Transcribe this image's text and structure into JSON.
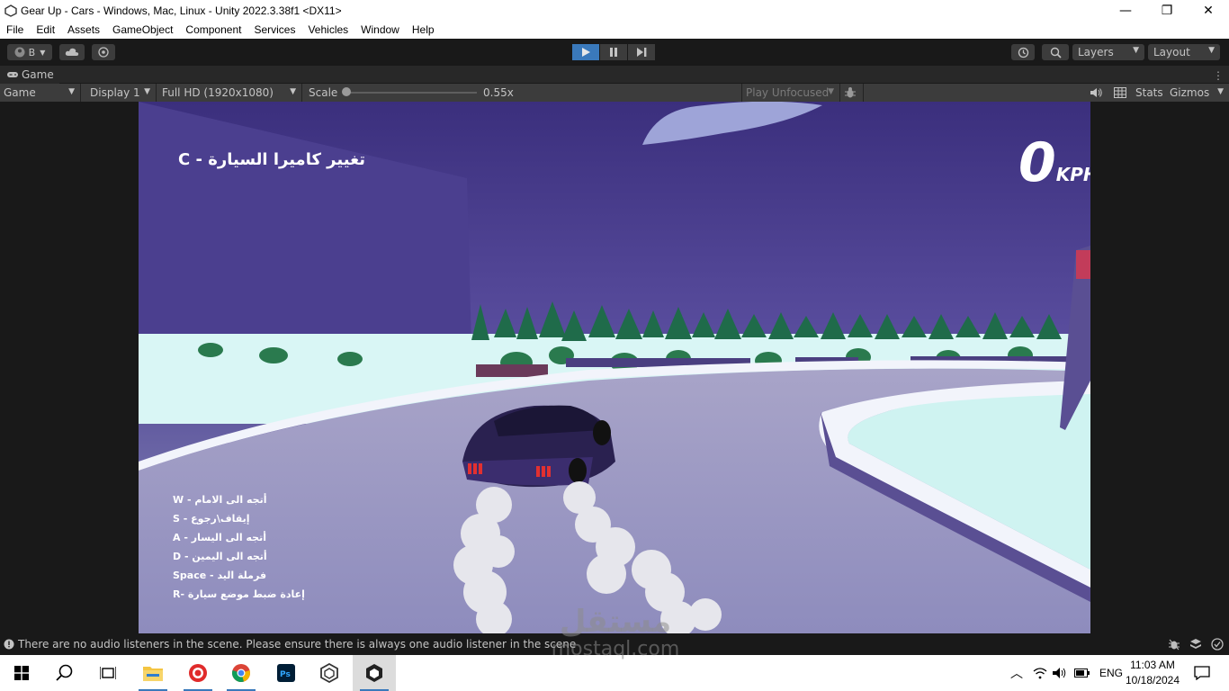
{
  "window": {
    "title": "Gear Up - Cars - Windows, Mac, Linux - Unity 2022.3.38f1 <DX11>",
    "minimize": "—",
    "maximize": "❐",
    "close": "✕"
  },
  "menu": [
    "File",
    "Edit",
    "Assets",
    "GameObject",
    "Component",
    "Services",
    "Vehicles",
    "Window",
    "Help"
  ],
  "toolbar": {
    "account_label": "B",
    "layers_label": "Layers",
    "layout_label": "Layout"
  },
  "tab": {
    "label": "Game"
  },
  "gamebar": {
    "mode": "Game",
    "display": "Display 1",
    "resolution": "Full HD (1920x1080)",
    "scale_label": "Scale",
    "scale_value": "0.55x",
    "scale_fraction": 0.0,
    "play_focus": "Play Unfocused",
    "stats": "Stats",
    "gizmos": "Gizmos"
  },
  "hud": {
    "camera_hint": "تغيير كاميرا السيارة - C",
    "speed_value": "0",
    "speed_unit": "KPH",
    "controls": [
      "W - أتجه الى الامام",
      "S - إيقاف\\رجوع",
      "A - أتجه الى اليسار",
      "D - أتجه الى اليمين",
      "Space - فرملة اليد",
      "R- إعادة ضبط موضع سيارة"
    ]
  },
  "status": {
    "message": "There are no audio listeners in the scene. Please ensure there is always one audio listener in the scene"
  },
  "taskbar": {
    "language": "ENG",
    "time": "11:03 AM",
    "date": "10/18/2024"
  },
  "watermark": {
    "arabic": "مستقل",
    "latin": "mostaql.com"
  },
  "colors": {
    "sky": "#3f3380",
    "snow": "#d9f6f5",
    "road": "#a9a6c9",
    "tree": "#1f6b4a",
    "car": "#3b2d6e",
    "play_active": "#3a79bb"
  }
}
